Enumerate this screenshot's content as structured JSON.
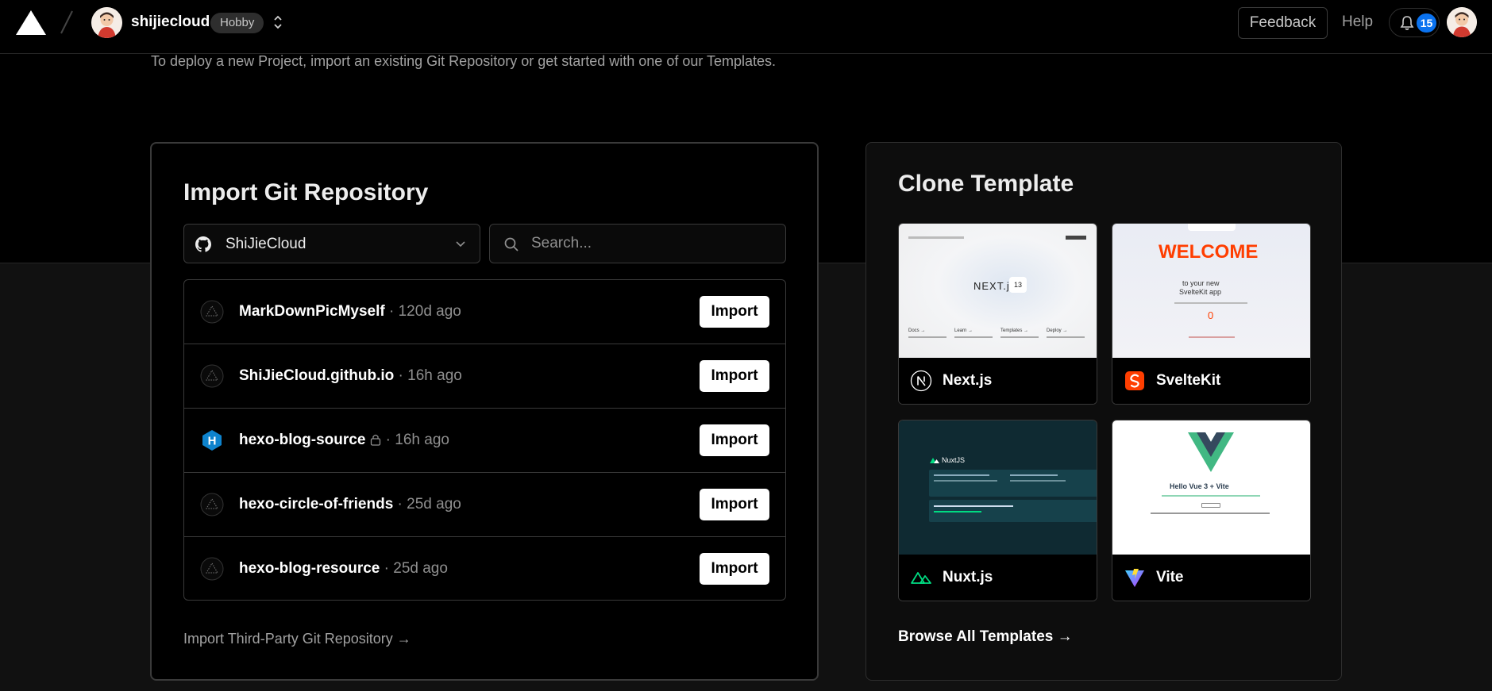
{
  "header": {
    "team_name": "shijiecloud",
    "plan_badge": "Hobby",
    "feedback_label": "Feedback",
    "help_label": "Help",
    "notification_count": "15"
  },
  "intro_text": "To deploy a new Project, import an existing Git Repository or get started with one of our Templates.",
  "import": {
    "title": "Import Git Repository",
    "account": "ShiJieCloud",
    "search_placeholder": "Search...",
    "repos": [
      {
        "name": "MarkDownPicMyself",
        "age": " · 120d ago",
        "icon": "vercel-triangle-icon",
        "button": "Import"
      },
      {
        "name": "ShiJieCloud.github.io",
        "age": " · 16h ago",
        "icon": "vercel-triangle-icon",
        "button": "Import"
      },
      {
        "name": "hexo-blog-source",
        "age": " · 16h ago",
        "icon": "hexo-logo-icon",
        "button": "Import",
        "private": true
      },
      {
        "name": "hexo-circle-of-friends",
        "age": " · 25d ago",
        "icon": "vercel-triangle-icon",
        "button": "Import"
      },
      {
        "name": "hexo-blog-resource",
        "age": " · 25d ago",
        "icon": "vercel-triangle-icon",
        "button": "Import"
      }
    ],
    "third_party_link": "Import Third-Party Git Repository →"
  },
  "templates": {
    "title": "Clone Template",
    "items": [
      {
        "name": "Next.js",
        "icon": "nextjs-logo-icon"
      },
      {
        "name": "SvelteKit",
        "icon": "svelte-logo-icon"
      },
      {
        "name": "Nuxt.js",
        "icon": "nuxt-logo-icon"
      },
      {
        "name": "Vite",
        "icon": "vite-logo-icon"
      }
    ],
    "browse_all": "Browse All Templates →",
    "previews": {
      "next_brand": "NEXT.js",
      "next_version": "13",
      "next_links": [
        "Docs →",
        "Learn →",
        "Templates →",
        "Deploy →"
      ],
      "svelte_heading": "WELCOME",
      "svelte_sub1": "to your new",
      "svelte_sub2": "SvelteKit app",
      "svelte_counter": "0",
      "nuxt_brand": "NuxtJS",
      "vite_heading": "Hello Vue 3 + Vite"
    }
  },
  "colors": {
    "accent_blue": "#0a72ef",
    "svelte_orange": "#ff3e00",
    "vue_green": "#41b883",
    "nuxt_bg": "#0f2a32"
  }
}
